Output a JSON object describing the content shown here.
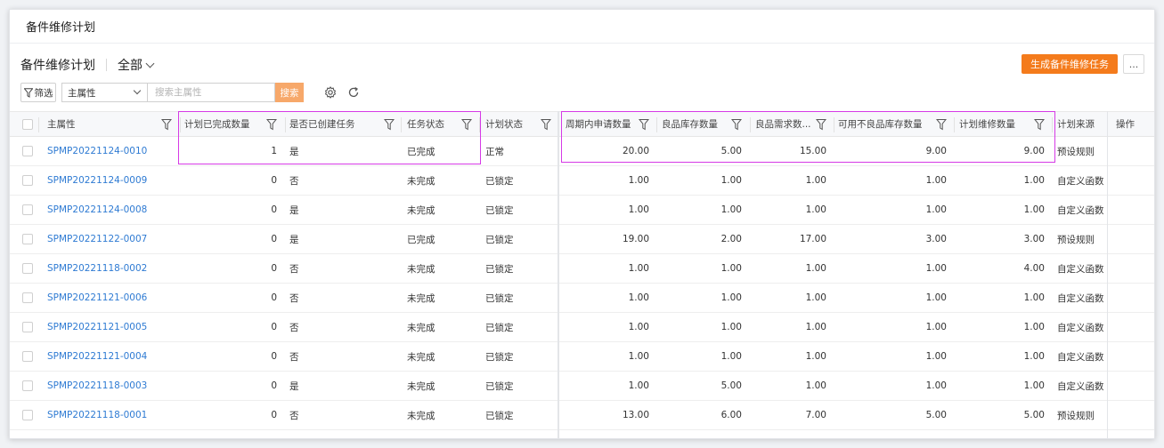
{
  "topbar": {
    "title": "备件维修计划"
  },
  "header": {
    "title": "备件维修计划",
    "scope": "全部"
  },
  "toolbar": {
    "generate_button": "生成备件维修任务",
    "more_button": "...",
    "filter_button": "筛选",
    "attr_select_value": "主属性",
    "search_placeholder": "搜索主属性",
    "search_button": "搜索"
  },
  "table": {
    "columns": {
      "main_attr": "主属性",
      "completed_qty": "计划已完成数量",
      "task_created": "是否已创建任务",
      "task_status": "任务状态",
      "plan_status": "计划状态",
      "period_apply_qty": "周期内申请数量",
      "good_stock_qty": "良品库存数量",
      "good_demand_qty": "良品需求数...",
      "usable_defect_qty": "可用不良品库存数量",
      "plan_repair_qty": "计划维修数量",
      "plan_source": "计划来源",
      "actions": "操作"
    },
    "rows": [
      {
        "id": "SPMP20221124-0010",
        "completed": "1",
        "created": "是",
        "task_status": "已完成",
        "plan_status": "正常",
        "apply": "20.00",
        "good_stock": "5.00",
        "good_demand": "15.00",
        "usable_defect": "9.00",
        "repair": "9.00",
        "source": "预设规则"
      },
      {
        "id": "SPMP20221124-0009",
        "completed": "0",
        "created": "否",
        "task_status": "未完成",
        "plan_status": "已锁定",
        "apply": "1.00",
        "good_stock": "1.00",
        "good_demand": "1.00",
        "usable_defect": "1.00",
        "repair": "1.00",
        "source": "自定义函数"
      },
      {
        "id": "SPMP20221124-0008",
        "completed": "0",
        "created": "是",
        "task_status": "未完成",
        "plan_status": "已锁定",
        "apply": "1.00",
        "good_stock": "1.00",
        "good_demand": "1.00",
        "usable_defect": "1.00",
        "repair": "1.00",
        "source": "自定义函数"
      },
      {
        "id": "SPMP20221122-0007",
        "completed": "0",
        "created": "是",
        "task_status": "已完成",
        "plan_status": "已锁定",
        "apply": "19.00",
        "good_stock": "2.00",
        "good_demand": "17.00",
        "usable_defect": "3.00",
        "repair": "3.00",
        "source": "预设规则"
      },
      {
        "id": "SPMP20221118-0002",
        "completed": "0",
        "created": "否",
        "task_status": "未完成",
        "plan_status": "已锁定",
        "apply": "1.00",
        "good_stock": "1.00",
        "good_demand": "1.00",
        "usable_defect": "1.00",
        "repair": "4.00",
        "source": "自定义函数"
      },
      {
        "id": "SPMP20221121-0006",
        "completed": "0",
        "created": "否",
        "task_status": "未完成",
        "plan_status": "已锁定",
        "apply": "1.00",
        "good_stock": "1.00",
        "good_demand": "1.00",
        "usable_defect": "1.00",
        "repair": "1.00",
        "source": "自定义函数"
      },
      {
        "id": "SPMP20221121-0005",
        "completed": "0",
        "created": "否",
        "task_status": "未完成",
        "plan_status": "已锁定",
        "apply": "1.00",
        "good_stock": "1.00",
        "good_demand": "1.00",
        "usable_defect": "1.00",
        "repair": "1.00",
        "source": "自定义函数"
      },
      {
        "id": "SPMP20221121-0004",
        "completed": "0",
        "created": "否",
        "task_status": "未完成",
        "plan_status": "已锁定",
        "apply": "1.00",
        "good_stock": "1.00",
        "good_demand": "1.00",
        "usable_defect": "1.00",
        "repair": "1.00",
        "source": "自定义函数"
      },
      {
        "id": "SPMP20221118-0003",
        "completed": "0",
        "created": "是",
        "task_status": "未完成",
        "plan_status": "已锁定",
        "apply": "1.00",
        "good_stock": "5.00",
        "good_demand": "1.00",
        "usable_defect": "1.00",
        "repair": "1.00",
        "source": "自定义函数"
      },
      {
        "id": "SPMP20221118-0001",
        "completed": "0",
        "created": "否",
        "task_status": "未完成",
        "plan_status": "已锁定",
        "apply": "13.00",
        "good_stock": "6.00",
        "good_demand": "7.00",
        "usable_defect": "5.00",
        "repair": "5.00",
        "source": "预设规则"
      }
    ]
  },
  "colors": {
    "accent": "#f47b1c",
    "link": "#2f7bd3",
    "highlight": "#d63ae6"
  },
  "icons": [
    "filter-icon",
    "chevron-down-icon",
    "settings-icon",
    "refresh-icon",
    "funnel-icon"
  ]
}
